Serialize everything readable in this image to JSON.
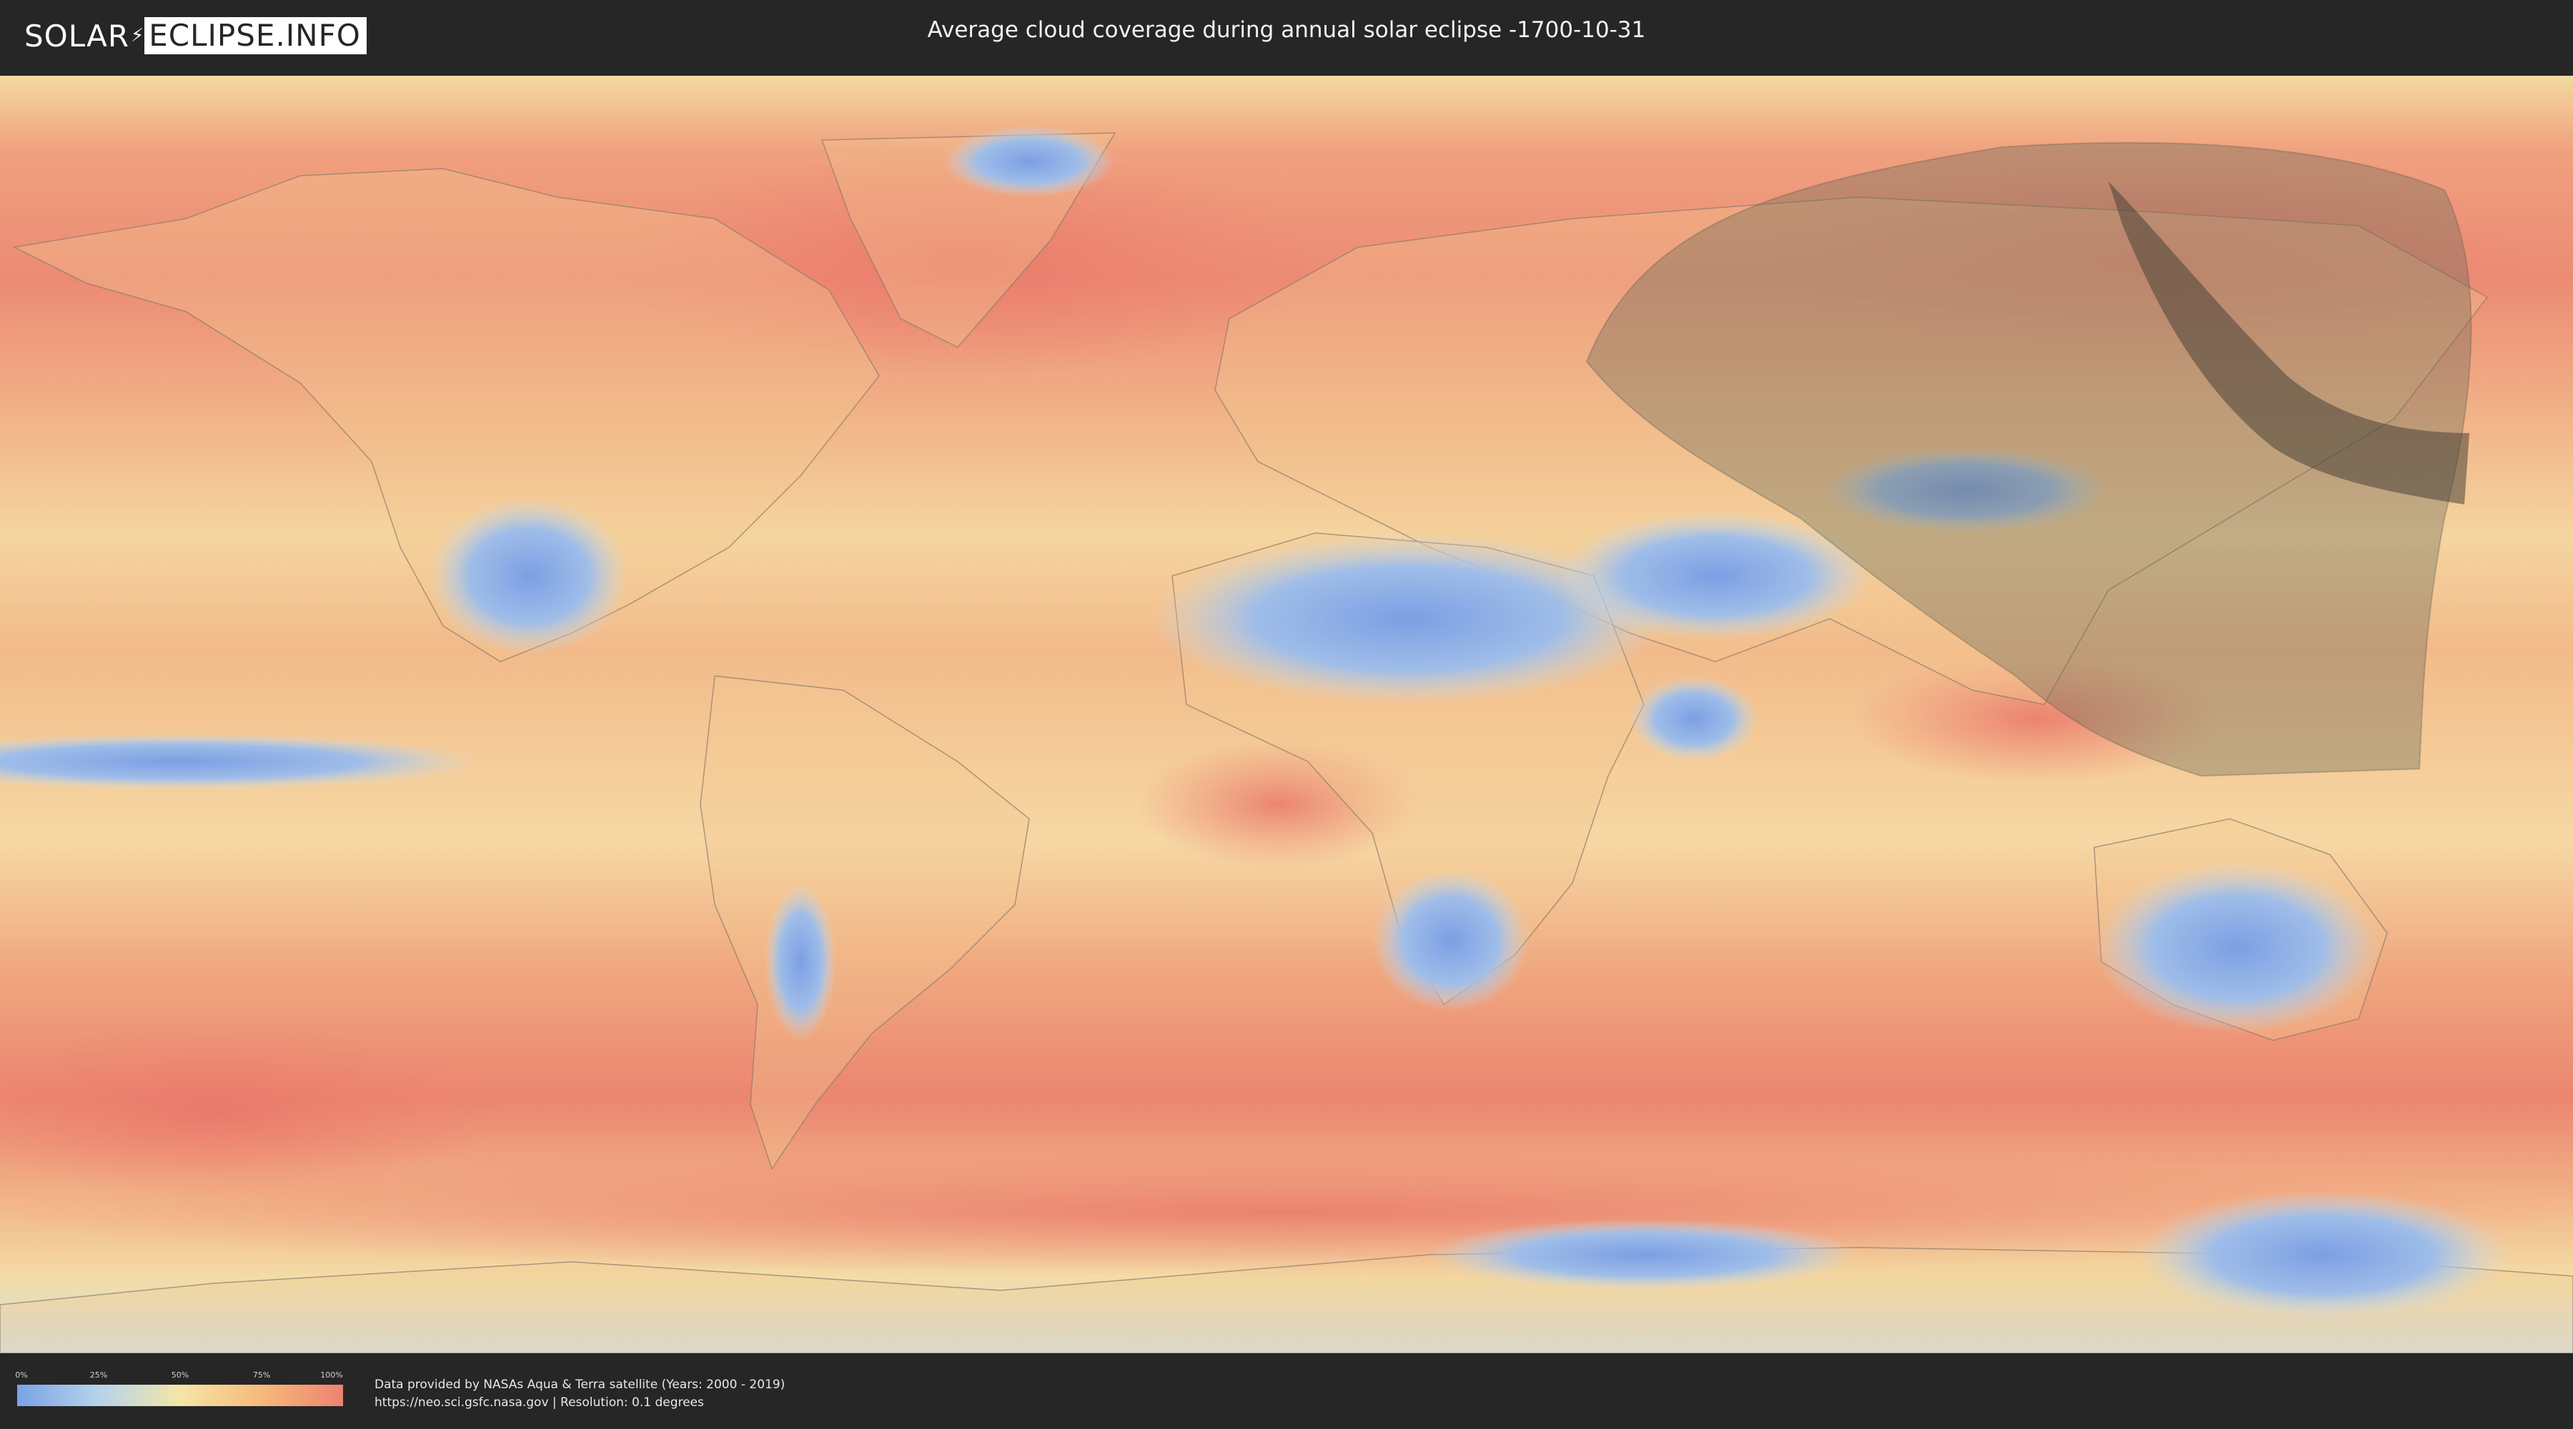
{
  "header": {
    "logo_left": "SOLAR",
    "logo_right": "ECLIPSE.INFO",
    "title": "Average cloud coverage during annual solar eclipse -1700-10-31"
  },
  "map": {
    "layer": "average cloud coverage",
    "colors": {
      "clear": "#7aa2e6",
      "low": "#b6d3ea",
      "mid": "#f4e6a8",
      "high": "#f6b97a",
      "overcast": "#ee8270",
      "eclipse_penumbra": "#6b6b5a",
      "eclipse_path": "#4a4338"
    }
  },
  "legend": {
    "ticks": [
      "0%",
      "25%",
      "50%",
      "75%",
      "100%"
    ]
  },
  "footer": {
    "credit_line1": "Data provided by NASAs Aqua & Terra satellite (Years: 2000 - 2019)",
    "credit_line2": "https://neo.sci.gsfc.nasa.gov | Resolution: 0.1 degrees"
  }
}
